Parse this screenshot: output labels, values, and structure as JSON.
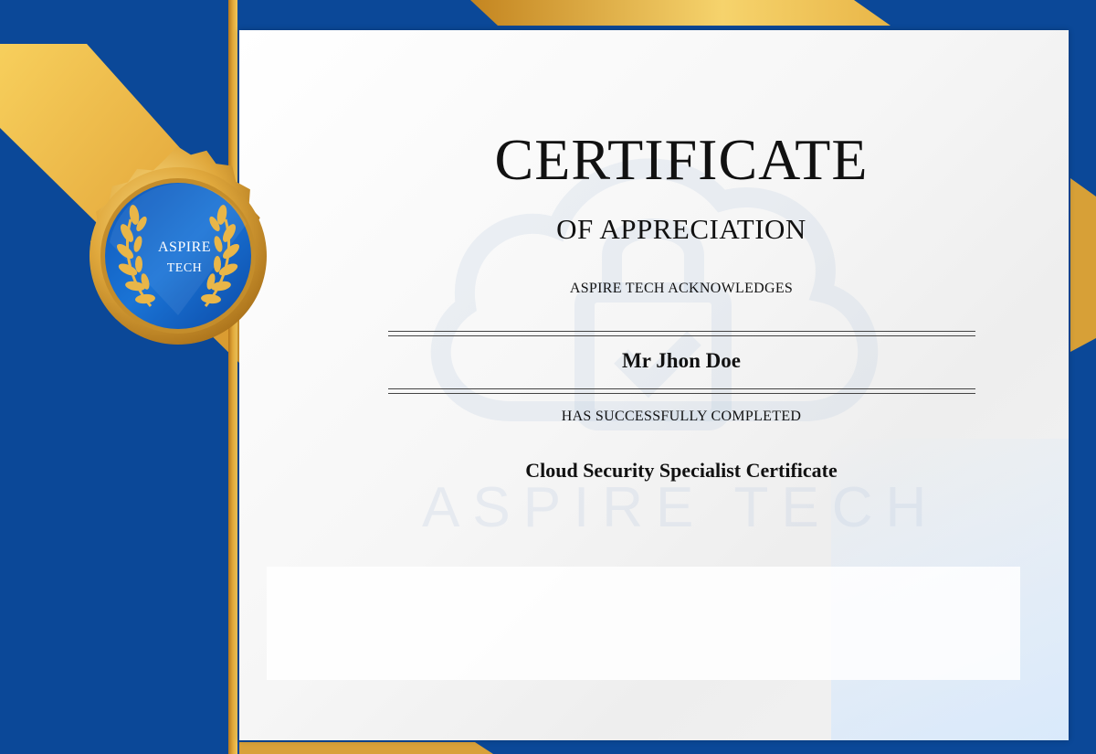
{
  "certificate": {
    "title": "CERTIFICATE",
    "subtitle": "OF APPRECIATION",
    "acknowledgement": "ASPIRE TECH ACKNOWLEDGES",
    "recipient_name": "Mr Jhon Doe",
    "completion_text": "HAS SUCCESSFULLY COMPLETED",
    "course_name": "Cloud Security Specialist Certificate"
  },
  "seal": {
    "line1": "ASPIRE",
    "line2": "TECH",
    "icon": "laurel-wreath-icon"
  },
  "watermark": {
    "text": "ASPIRE TECH",
    "icon": "cloud-lock-icon"
  },
  "colors": {
    "primary_blue": "#0b4898",
    "gold": "#e2a93a",
    "dark_gold": "#b67b1c",
    "paper": "#f4f4f4",
    "text": "#111111"
  }
}
